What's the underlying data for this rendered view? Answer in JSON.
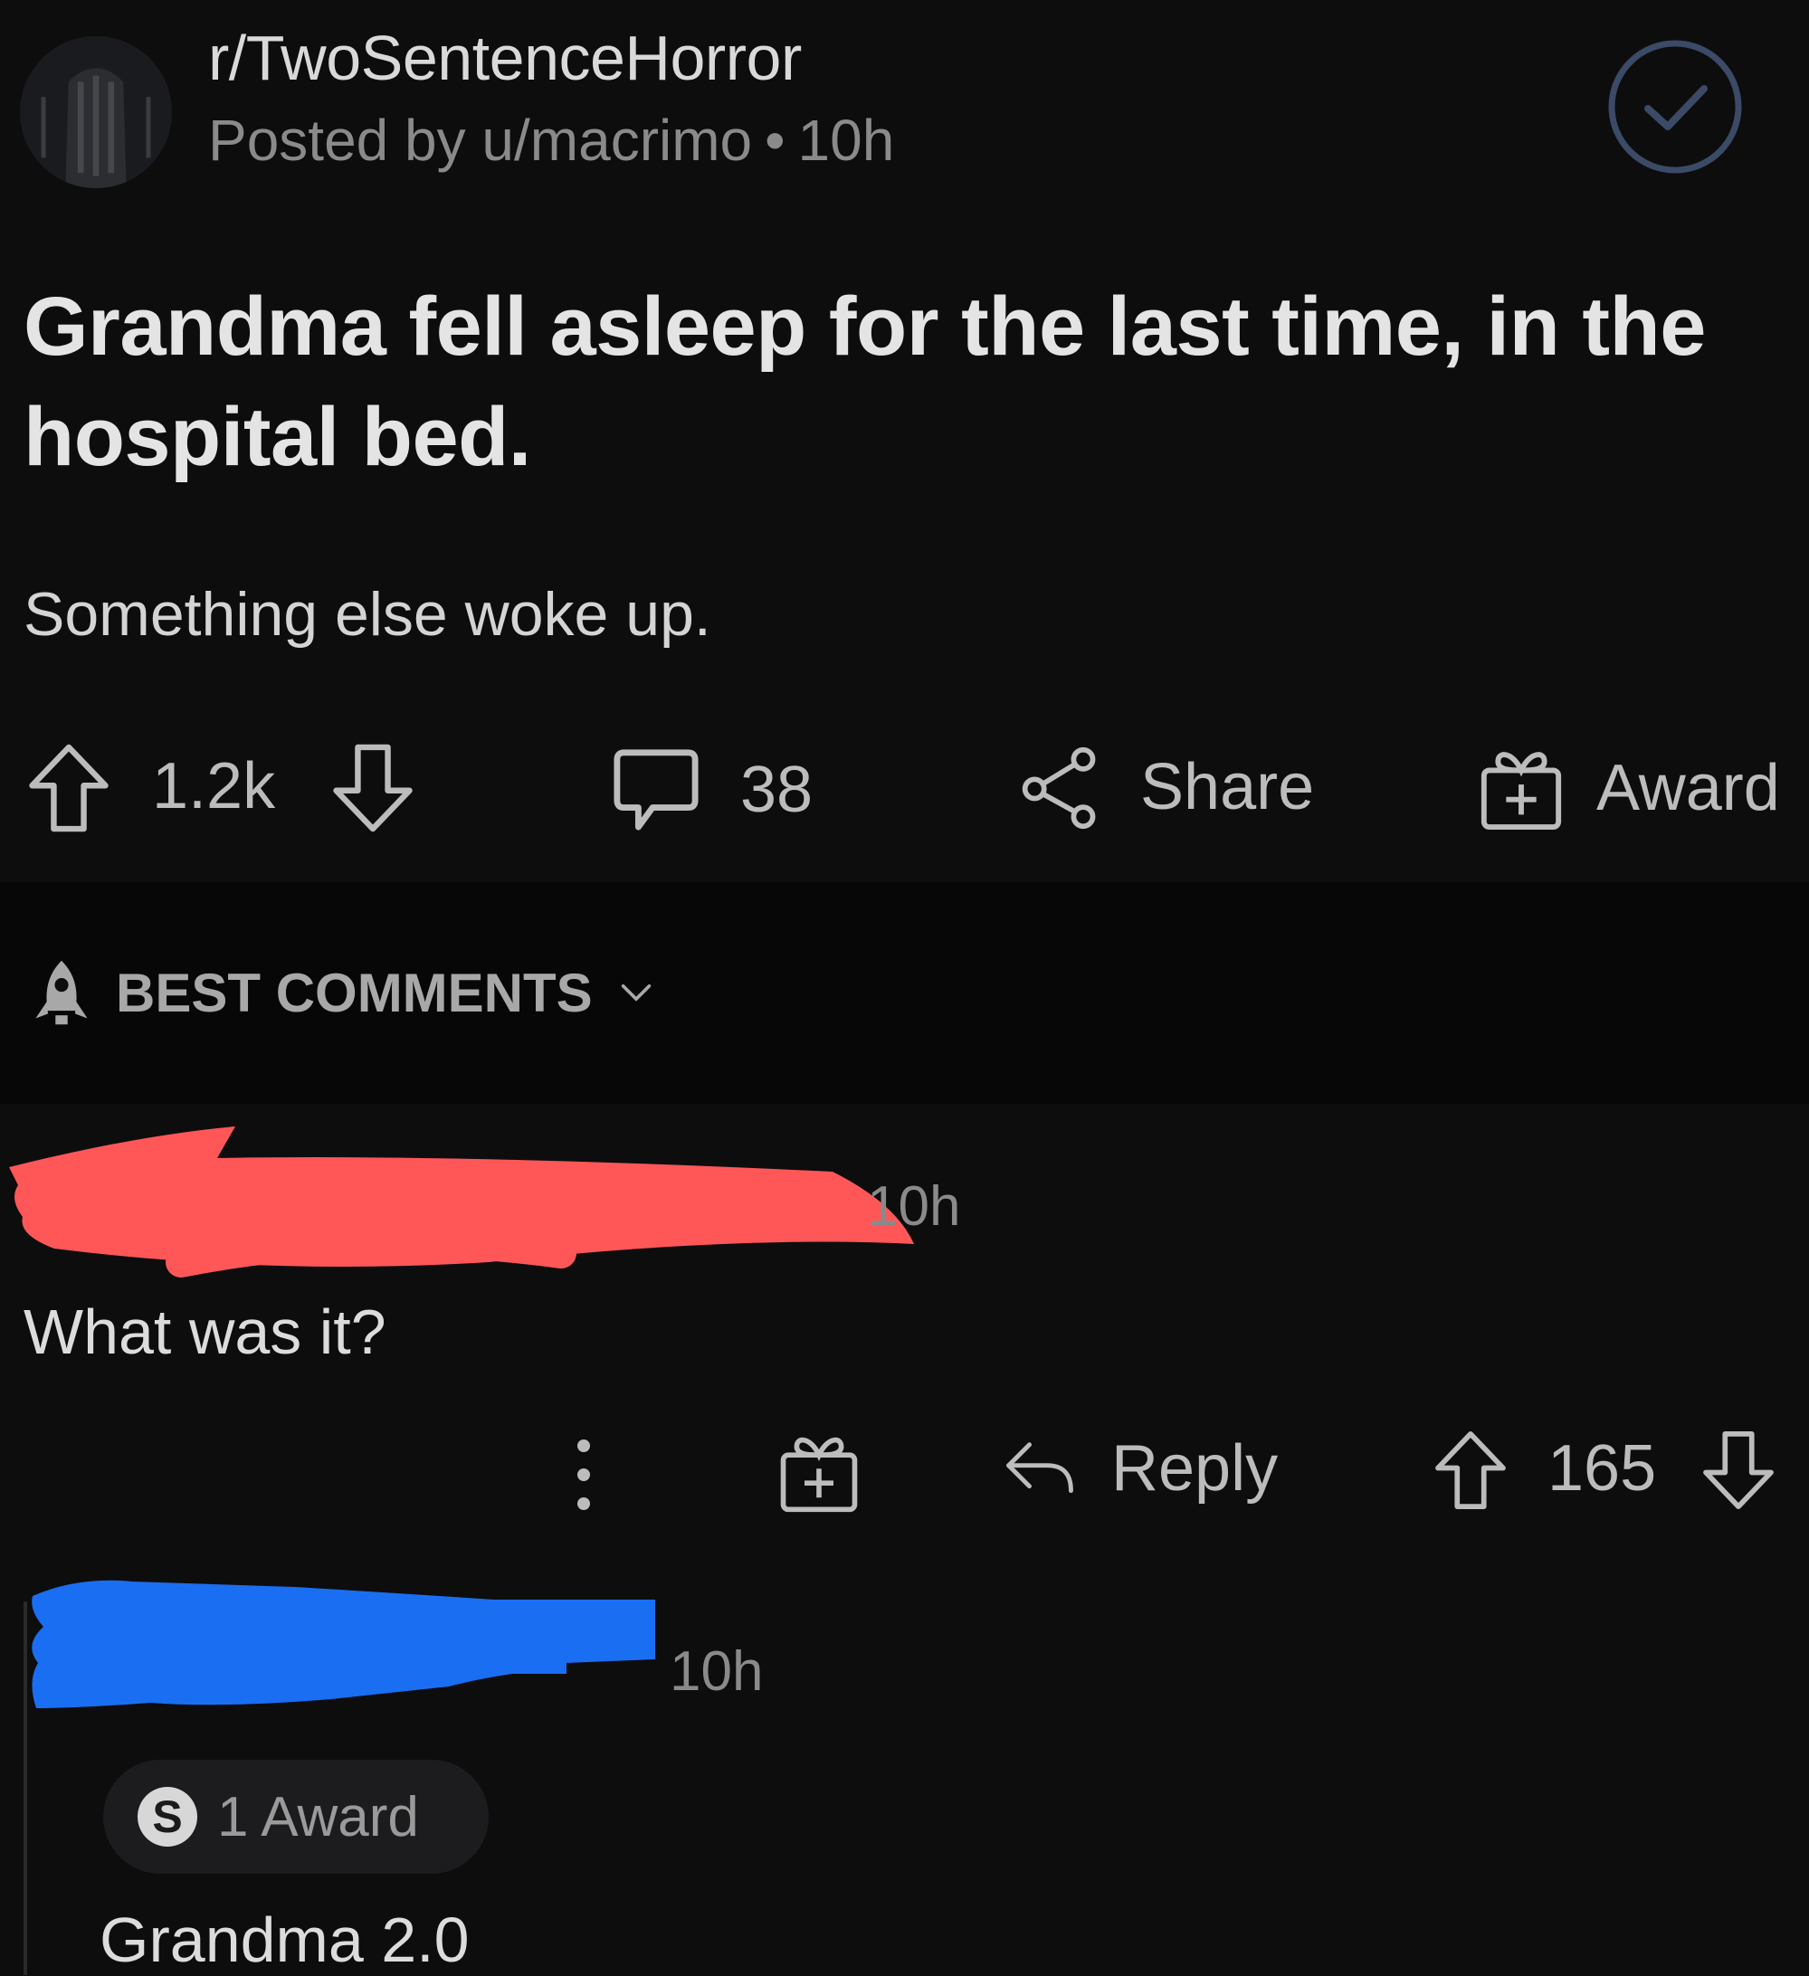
{
  "post": {
    "subreddit": "r/TwoSentenceHorror",
    "posted_by": "Posted by u/macrimo",
    "separator": "•",
    "age": "10h",
    "title": "Grandma fell asleep for the last time, in the hospital bed.",
    "body": "Something else woke up.",
    "votes": "1.2k",
    "comments": "38",
    "share_label": "Share",
    "award_label": "Award"
  },
  "sort": {
    "label": "BEST COMMENTS"
  },
  "comments": [
    {
      "author_redaction_color": "#ff5757",
      "age": "10h",
      "text": "What was it?",
      "reply_label": "Reply",
      "votes": "165"
    },
    {
      "author_redaction_color": "#1a6ef2",
      "age": "10h",
      "award_text": "1 Award",
      "award_icon_letter": "S",
      "text": "Grandma 2.0"
    }
  ],
  "icons": {
    "joined": "check-circle-icon",
    "upvote": "arrow-up-icon",
    "downvote": "arrow-down-icon",
    "comment": "speech-bubble-icon",
    "share": "share-nodes-icon",
    "award": "gift-box-icon",
    "sort": "rocket-icon",
    "more": "vertical-dots-icon",
    "reply": "reply-arrow-icon",
    "silver": "silver-award-icon"
  },
  "colors": {
    "background": "#0d0d0e",
    "text": "#dcdcdc",
    "muted": "#8a8a8a",
    "joined_accent": "#3b4a66"
  }
}
